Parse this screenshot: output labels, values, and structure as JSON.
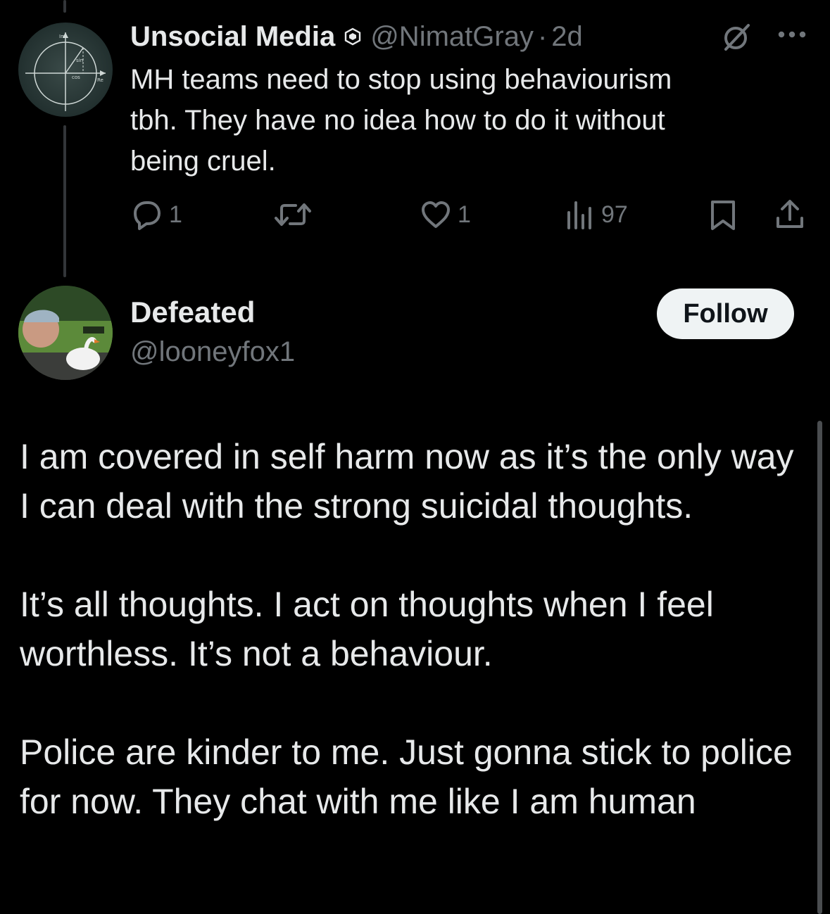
{
  "colors": {
    "background": "#000000",
    "text_primary": "#e7e9ea",
    "text_secondary": "#71767b",
    "follow_button_bg": "#eff3f4",
    "follow_button_text": "#0f1419"
  },
  "post1": {
    "display_name": "Unsocial Media",
    "badge_icon": "hexagon-badge-icon",
    "handle": "@NimatGray",
    "separator": "·",
    "time": "2d",
    "text": "MH teams need to stop using behaviourism\ntbh. They have no idea how to do it without\nbeing cruel.",
    "actions": {
      "reply_count": "1",
      "repost_count": "",
      "like_count": "1",
      "views_count": "97"
    },
    "icons": [
      "grok-icon",
      "more-icon",
      "reply-icon",
      "repost-icon",
      "like-icon",
      "views-icon",
      "bookmark-icon",
      "share-icon"
    ]
  },
  "post2": {
    "display_name": "Defeated",
    "handle": "@looneyfox1",
    "follow_label": "Follow",
    "paragraphs": [
      "I am covered in self harm now as it’s the only way I can deal with the strong suicidal thoughts.",
      "It’s all thoughts.  I act on thoughts when I feel worthless.  It’s not a behaviour.",
      "Police are kinder to me.  Just gonna stick to police for now.  They chat with me like I am human"
    ]
  }
}
